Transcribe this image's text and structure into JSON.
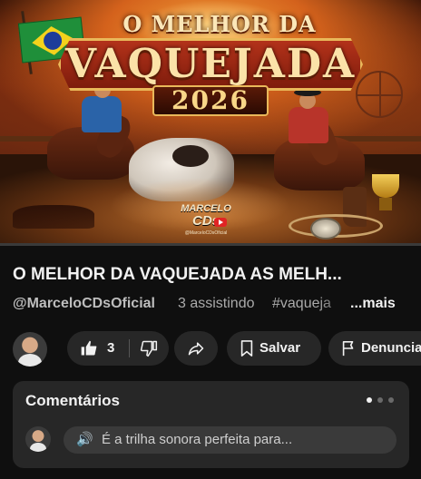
{
  "thumbnail": {
    "title_line1": "O MELHOR DA",
    "title_line2": "VAQUEJADA",
    "year": "2026",
    "logo_line1": "MARCELO",
    "logo_line2": "CDs",
    "logo_line3": "@MarceloCDsOficial"
  },
  "video": {
    "title": "O MELHOR DA VAQUEJADA AS MELH...",
    "channel": "@MarceloCDsOficial",
    "viewers": "3 assistindo",
    "hashtag": "#vaqueja",
    "more": "...mais"
  },
  "actions": {
    "like_count": "3",
    "save_label": "Salvar",
    "report_label": "Denunciar"
  },
  "comments": {
    "title": "Comentários",
    "preview_emoji": "🔊",
    "preview_text": "É a trilha sonora perfeita para..."
  },
  "colors": {
    "background": "#0f0f0f",
    "pill": "#272727",
    "text": "#f1f1f1",
    "muted": "#aaaaaa"
  }
}
